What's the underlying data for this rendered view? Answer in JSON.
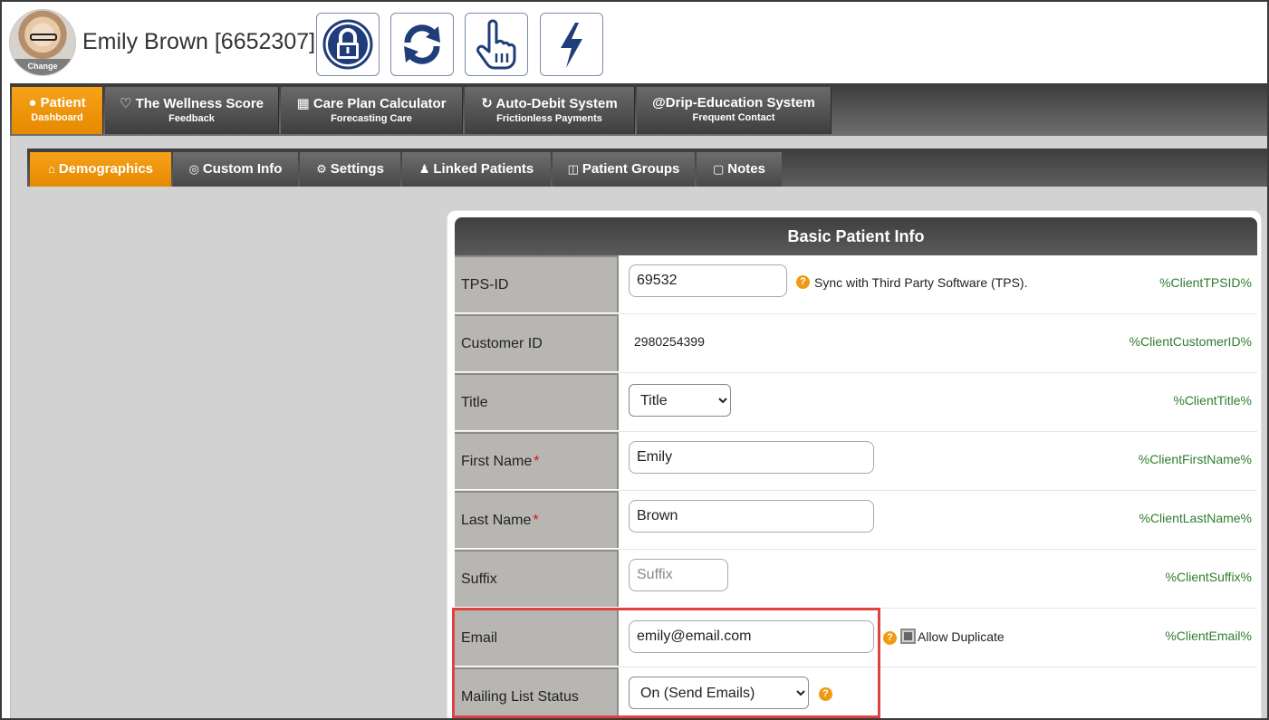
{
  "header": {
    "avatar_change_label": "Change",
    "patient_name": "Emily Brown [6652307]",
    "buttons": [
      {
        "icon": "lock-icon"
      },
      {
        "icon": "refresh-icon"
      },
      {
        "icon": "pointer-hand-icon"
      },
      {
        "icon": "lightning-icon"
      }
    ]
  },
  "main_nav": {
    "tabs": [
      {
        "icon": "user-icon",
        "label": "Patient",
        "sub": "Dashboard",
        "active": true
      },
      {
        "icon": "heartbeat-icon",
        "label": "The Wellness Score",
        "sub": "Feedback"
      },
      {
        "icon": "calculator-icon",
        "label": "Care Plan Calculator",
        "sub": "Forecasting Care"
      },
      {
        "icon": "refresh-icon",
        "label": "Auto-Debit System",
        "sub": "Frictionless Payments"
      },
      {
        "icon": "at-icon",
        "label": "Drip-Education System",
        "sub": "Frequent Contact"
      }
    ]
  },
  "sub_nav": {
    "tabs": [
      {
        "icon": "home-icon",
        "label": "Demographics",
        "active": true
      },
      {
        "icon": "target-icon",
        "label": "Custom Info"
      },
      {
        "icon": "gear-icon",
        "label": "Settings"
      },
      {
        "icon": "users-icon",
        "label": "Linked Patients"
      },
      {
        "icon": "group-icon",
        "label": "Patient Groups"
      },
      {
        "icon": "note-icon",
        "label": "Notes"
      }
    ]
  },
  "panel": {
    "title": "Basic Patient Info",
    "rows": {
      "tps_id": {
        "label": "TPS-ID",
        "value": "69532",
        "help_text": "Sync with Third Party Software (TPS).",
        "tag": "%ClientTPSID%"
      },
      "customer_id": {
        "label": "Customer ID",
        "value": "2980254399",
        "tag": "%ClientCustomerID%"
      },
      "title": {
        "label": "Title",
        "value": "Title",
        "tag": "%ClientTitle%"
      },
      "first_name": {
        "label": "First Name",
        "value": "Emily",
        "tag": "%ClientFirstName%"
      },
      "last_name": {
        "label": "Last Name",
        "value": "Brown",
        "tag": "%ClientLastName%"
      },
      "suffix": {
        "label": "Suffix",
        "value": "",
        "placeholder": "Suffix",
        "tag": "%ClientSuffix%"
      },
      "email": {
        "label": "Email",
        "value": "emily@email.com",
        "checkbox_label": "Allow Duplicate",
        "tag": "%ClientEmail%"
      },
      "mailing_list": {
        "label": "Mailing List Status",
        "value": "On (Send Emails)"
      }
    },
    "required_marker": "*",
    "help_glyph": "?"
  },
  "colors": {
    "accent_orange": "#f39a12",
    "nav_dark": "#3b3b3b",
    "tag_green": "#2e7d2e",
    "highlight_red": "#e0433f",
    "brand_blue": "#1f3d7a"
  }
}
